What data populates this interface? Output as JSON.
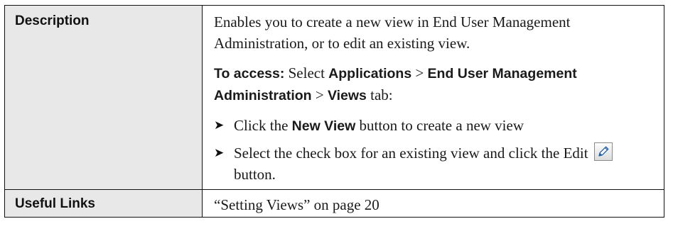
{
  "rows": [
    {
      "label": "Description",
      "content": {
        "intro": "Enables you to create a new view in End User Management Administration, or to edit an existing view.",
        "access": {
          "prefix": "To access:",
          "select_word": "Select",
          "path_1": "Applications",
          "sep_1": ">",
          "path_2": "End User Management Administration",
          "sep_2": ">",
          "path_3": "Views",
          "suffix": "tab:"
        },
        "bullets": [
          {
            "before": "Click the",
            "bold": "New View",
            "after": "button to create a new view"
          },
          {
            "before": "Select the check box for an existing view and click the Edit",
            "icon": "edit-pencil-icon",
            "after": "button."
          }
        ],
        "bullet_glyph": "➤"
      }
    },
    {
      "label": "Useful Links",
      "content": {
        "link_text": "“Setting Views” on page 20"
      }
    }
  ],
  "colors": {
    "label_bg": "#e8e8e8",
    "border": "#111111",
    "text": "#1a1a1a"
  }
}
